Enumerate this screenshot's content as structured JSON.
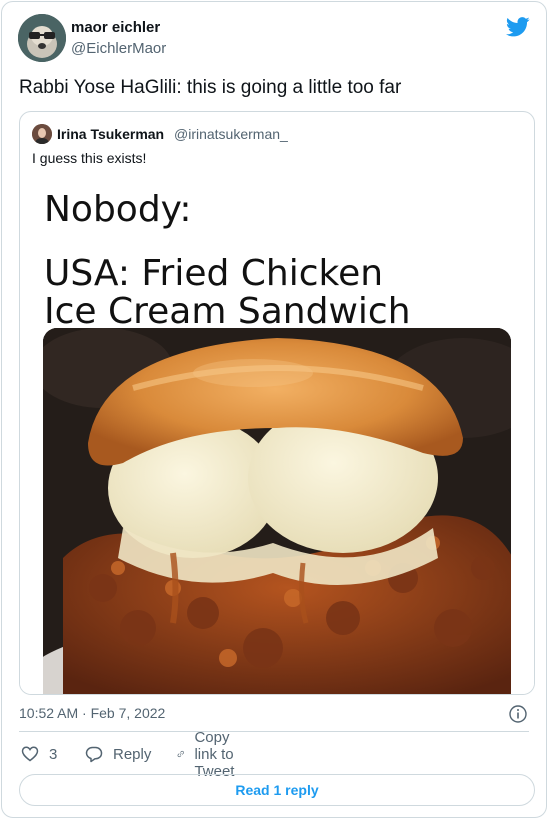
{
  "author": {
    "name": "maor eichler",
    "handle": "@EichlerMaor"
  },
  "tweet": {
    "text": "Rabbi Yose HaGlili: this is going a little too far"
  },
  "quoted": {
    "name": "Irina Tsukerman",
    "handle": "@irinatsukerman_",
    "text": "I guess this exists!",
    "image_text": [
      "Nobody:",
      "USA: Fried Chicken",
      "Ice Cream Sandwich"
    ]
  },
  "meta": {
    "timestamp": "10:52 AM · Feb 7, 2022"
  },
  "actions": {
    "like_count": "3",
    "reply": "Reply",
    "copy": "Copy link to Tweet"
  },
  "read_replies": "Read 1 reply",
  "colors": {
    "accent": "#1d9bf0",
    "text": "#0f1419",
    "muted": "#536471",
    "border": "#cfd9de"
  },
  "icons": [
    "twitter-bird-icon",
    "info-icon",
    "heart-icon",
    "reply-bubble-icon",
    "link-icon"
  ]
}
